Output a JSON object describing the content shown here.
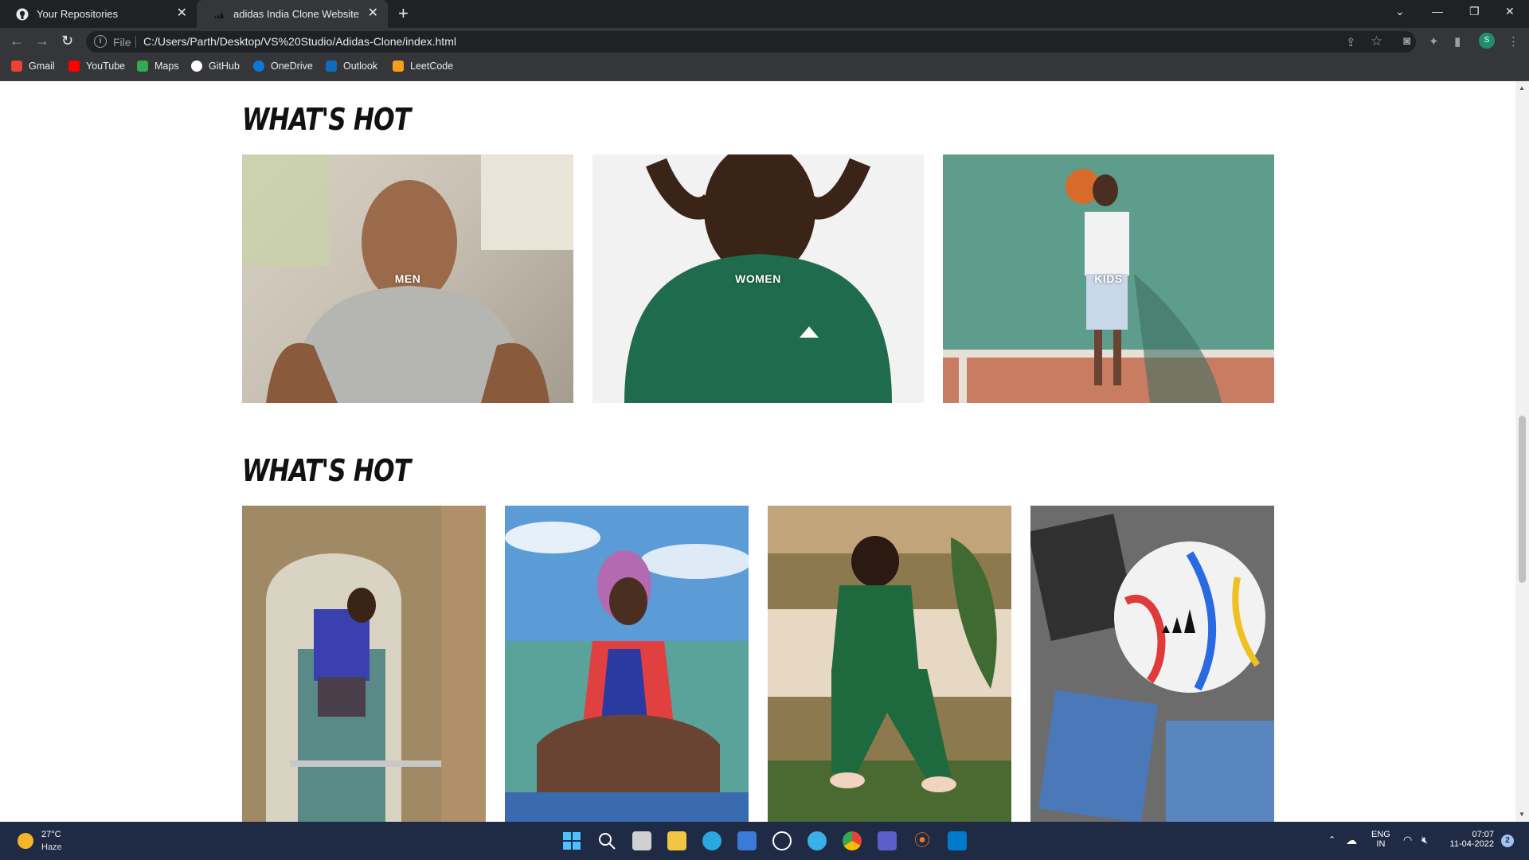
{
  "browser": {
    "tabs": [
      {
        "label": "Your Repositories",
        "active": false,
        "icon": "github-icon"
      },
      {
        "label": "adidas India Clone Website",
        "active": true,
        "icon": "adidas-icon"
      }
    ],
    "address": {
      "scheme": "File",
      "url": "C:/Users/Parth/Desktop/VS%20Studio/Adidas-Clone/index.html"
    },
    "bookmarks": [
      {
        "label": "Gmail",
        "icon": "gmail-icon",
        "color": "#ea4335"
      },
      {
        "label": "YouTube",
        "icon": "youtube-icon",
        "color": "#ff0000"
      },
      {
        "label": "Maps",
        "icon": "maps-icon",
        "color": "#34a853"
      },
      {
        "label": "GitHub",
        "icon": "github-icon",
        "color": "#ffffff"
      },
      {
        "label": "OneDrive",
        "icon": "onedrive-icon",
        "color": "#0f78d4"
      },
      {
        "label": "Outlook",
        "icon": "outlook-icon",
        "color": "#0f6cbd"
      },
      {
        "label": "LeetCode",
        "icon": "leetcode-icon",
        "color": "#f89f1b"
      }
    ],
    "profile_initial": "S"
  },
  "page": {
    "sections": [
      {
        "title": "WHAT'S HOT",
        "cards": [
          {
            "label": "MEN",
            "image": "man-grey-tshirt-photo"
          },
          {
            "label": "WOMEN",
            "image": "woman-green-shirt-photo"
          },
          {
            "label": "KIDS",
            "image": "kid-basketball-wall-photo"
          }
        ]
      },
      {
        "title": "WHAT'S HOT",
        "cards": [
          {
            "label": "",
            "image": "person-window-ledge-photo"
          },
          {
            "label": "",
            "image": "woman-swimsuit-beach-photo"
          },
          {
            "label": "",
            "image": "woman-green-tracksuit-photo"
          },
          {
            "label": "",
            "image": "world-cup-football-photo"
          }
        ]
      }
    ]
  },
  "taskbar": {
    "weather": {
      "temp": "27°C",
      "condition": "Haze"
    },
    "language": {
      "line1": "ENG",
      "line2": "IN"
    },
    "clock": {
      "time": "07:07",
      "date": "11-04-2022"
    },
    "notifications": "2"
  }
}
